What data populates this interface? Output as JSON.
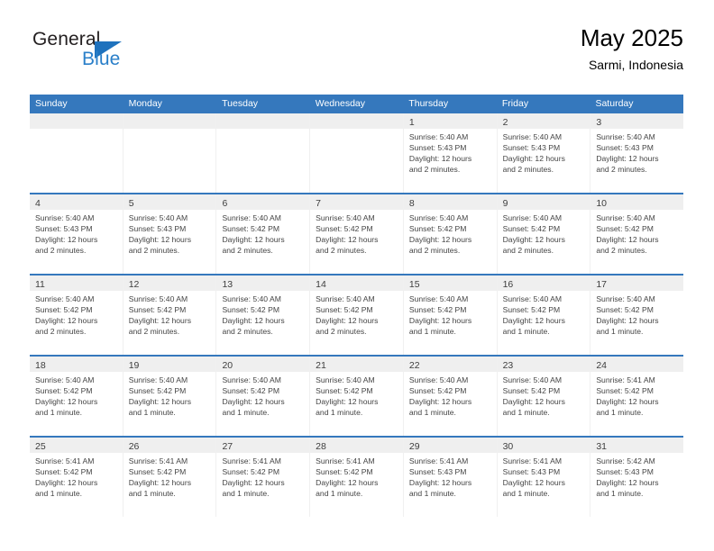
{
  "brand": {
    "name_part1": "General",
    "name_part2": "Blue",
    "accent_color": "#2a7fc9",
    "triangle_color": "#1f72bd"
  },
  "header": {
    "title": "May 2025",
    "subtitle": "Sarmi, Indonesia",
    "weekday_bar_color": "#3578bd"
  },
  "weekdays": [
    "Sunday",
    "Monday",
    "Tuesday",
    "Wednesday",
    "Thursday",
    "Friday",
    "Saturday"
  ],
  "weeks": [
    [
      {
        "day": "",
        "sunrise": "",
        "sunset": "",
        "daylight_line1": "",
        "daylight_line2": "",
        "empty": true
      },
      {
        "day": "",
        "sunrise": "",
        "sunset": "",
        "daylight_line1": "",
        "daylight_line2": "",
        "empty": true
      },
      {
        "day": "",
        "sunrise": "",
        "sunset": "",
        "daylight_line1": "",
        "daylight_line2": "",
        "empty": true
      },
      {
        "day": "",
        "sunrise": "",
        "sunset": "",
        "daylight_line1": "",
        "daylight_line2": "",
        "empty": true
      },
      {
        "day": "1",
        "sunrise": "Sunrise: 5:40 AM",
        "sunset": "Sunset: 5:43 PM",
        "daylight_line1": "Daylight: 12 hours",
        "daylight_line2": "and 2 minutes."
      },
      {
        "day": "2",
        "sunrise": "Sunrise: 5:40 AM",
        "sunset": "Sunset: 5:43 PM",
        "daylight_line1": "Daylight: 12 hours",
        "daylight_line2": "and 2 minutes."
      },
      {
        "day": "3",
        "sunrise": "Sunrise: 5:40 AM",
        "sunset": "Sunset: 5:43 PM",
        "daylight_line1": "Daylight: 12 hours",
        "daylight_line2": "and 2 minutes."
      }
    ],
    [
      {
        "day": "4",
        "sunrise": "Sunrise: 5:40 AM",
        "sunset": "Sunset: 5:43 PM",
        "daylight_line1": "Daylight: 12 hours",
        "daylight_line2": "and 2 minutes."
      },
      {
        "day": "5",
        "sunrise": "Sunrise: 5:40 AM",
        "sunset": "Sunset: 5:43 PM",
        "daylight_line1": "Daylight: 12 hours",
        "daylight_line2": "and 2 minutes."
      },
      {
        "day": "6",
        "sunrise": "Sunrise: 5:40 AM",
        "sunset": "Sunset: 5:42 PM",
        "daylight_line1": "Daylight: 12 hours",
        "daylight_line2": "and 2 minutes."
      },
      {
        "day": "7",
        "sunrise": "Sunrise: 5:40 AM",
        "sunset": "Sunset: 5:42 PM",
        "daylight_line1": "Daylight: 12 hours",
        "daylight_line2": "and 2 minutes."
      },
      {
        "day": "8",
        "sunrise": "Sunrise: 5:40 AM",
        "sunset": "Sunset: 5:42 PM",
        "daylight_line1": "Daylight: 12 hours",
        "daylight_line2": "and 2 minutes."
      },
      {
        "day": "9",
        "sunrise": "Sunrise: 5:40 AM",
        "sunset": "Sunset: 5:42 PM",
        "daylight_line1": "Daylight: 12 hours",
        "daylight_line2": "and 2 minutes."
      },
      {
        "day": "10",
        "sunrise": "Sunrise: 5:40 AM",
        "sunset": "Sunset: 5:42 PM",
        "daylight_line1": "Daylight: 12 hours",
        "daylight_line2": "and 2 minutes."
      }
    ],
    [
      {
        "day": "11",
        "sunrise": "Sunrise: 5:40 AM",
        "sunset": "Sunset: 5:42 PM",
        "daylight_line1": "Daylight: 12 hours",
        "daylight_line2": "and 2 minutes."
      },
      {
        "day": "12",
        "sunrise": "Sunrise: 5:40 AM",
        "sunset": "Sunset: 5:42 PM",
        "daylight_line1": "Daylight: 12 hours",
        "daylight_line2": "and 2 minutes."
      },
      {
        "day": "13",
        "sunrise": "Sunrise: 5:40 AM",
        "sunset": "Sunset: 5:42 PM",
        "daylight_line1": "Daylight: 12 hours",
        "daylight_line2": "and 2 minutes."
      },
      {
        "day": "14",
        "sunrise": "Sunrise: 5:40 AM",
        "sunset": "Sunset: 5:42 PM",
        "daylight_line1": "Daylight: 12 hours",
        "daylight_line2": "and 2 minutes."
      },
      {
        "day": "15",
        "sunrise": "Sunrise: 5:40 AM",
        "sunset": "Sunset: 5:42 PM",
        "daylight_line1": "Daylight: 12 hours",
        "daylight_line2": "and 1 minute."
      },
      {
        "day": "16",
        "sunrise": "Sunrise: 5:40 AM",
        "sunset": "Sunset: 5:42 PM",
        "daylight_line1": "Daylight: 12 hours",
        "daylight_line2": "and 1 minute."
      },
      {
        "day": "17",
        "sunrise": "Sunrise: 5:40 AM",
        "sunset": "Sunset: 5:42 PM",
        "daylight_line1": "Daylight: 12 hours",
        "daylight_line2": "and 1 minute."
      }
    ],
    [
      {
        "day": "18",
        "sunrise": "Sunrise: 5:40 AM",
        "sunset": "Sunset: 5:42 PM",
        "daylight_line1": "Daylight: 12 hours",
        "daylight_line2": "and 1 minute."
      },
      {
        "day": "19",
        "sunrise": "Sunrise: 5:40 AM",
        "sunset": "Sunset: 5:42 PM",
        "daylight_line1": "Daylight: 12 hours",
        "daylight_line2": "and 1 minute."
      },
      {
        "day": "20",
        "sunrise": "Sunrise: 5:40 AM",
        "sunset": "Sunset: 5:42 PM",
        "daylight_line1": "Daylight: 12 hours",
        "daylight_line2": "and 1 minute."
      },
      {
        "day": "21",
        "sunrise": "Sunrise: 5:40 AM",
        "sunset": "Sunset: 5:42 PM",
        "daylight_line1": "Daylight: 12 hours",
        "daylight_line2": "and 1 minute."
      },
      {
        "day": "22",
        "sunrise": "Sunrise: 5:40 AM",
        "sunset": "Sunset: 5:42 PM",
        "daylight_line1": "Daylight: 12 hours",
        "daylight_line2": "and 1 minute."
      },
      {
        "day": "23",
        "sunrise": "Sunrise: 5:40 AM",
        "sunset": "Sunset: 5:42 PM",
        "daylight_line1": "Daylight: 12 hours",
        "daylight_line2": "and 1 minute."
      },
      {
        "day": "24",
        "sunrise": "Sunrise: 5:41 AM",
        "sunset": "Sunset: 5:42 PM",
        "daylight_line1": "Daylight: 12 hours",
        "daylight_line2": "and 1 minute."
      }
    ],
    [
      {
        "day": "25",
        "sunrise": "Sunrise: 5:41 AM",
        "sunset": "Sunset: 5:42 PM",
        "daylight_line1": "Daylight: 12 hours",
        "daylight_line2": "and 1 minute."
      },
      {
        "day": "26",
        "sunrise": "Sunrise: 5:41 AM",
        "sunset": "Sunset: 5:42 PM",
        "daylight_line1": "Daylight: 12 hours",
        "daylight_line2": "and 1 minute."
      },
      {
        "day": "27",
        "sunrise": "Sunrise: 5:41 AM",
        "sunset": "Sunset: 5:42 PM",
        "daylight_line1": "Daylight: 12 hours",
        "daylight_line2": "and 1 minute."
      },
      {
        "day": "28",
        "sunrise": "Sunrise: 5:41 AM",
        "sunset": "Sunset: 5:42 PM",
        "daylight_line1": "Daylight: 12 hours",
        "daylight_line2": "and 1 minute."
      },
      {
        "day": "29",
        "sunrise": "Sunrise: 5:41 AM",
        "sunset": "Sunset: 5:43 PM",
        "daylight_line1": "Daylight: 12 hours",
        "daylight_line2": "and 1 minute."
      },
      {
        "day": "30",
        "sunrise": "Sunrise: 5:41 AM",
        "sunset": "Sunset: 5:43 PM",
        "daylight_line1": "Daylight: 12 hours",
        "daylight_line2": "and 1 minute."
      },
      {
        "day": "31",
        "sunrise": "Sunrise: 5:42 AM",
        "sunset": "Sunset: 5:43 PM",
        "daylight_line1": "Daylight: 12 hours",
        "daylight_line2": "and 1 minute."
      }
    ]
  ]
}
